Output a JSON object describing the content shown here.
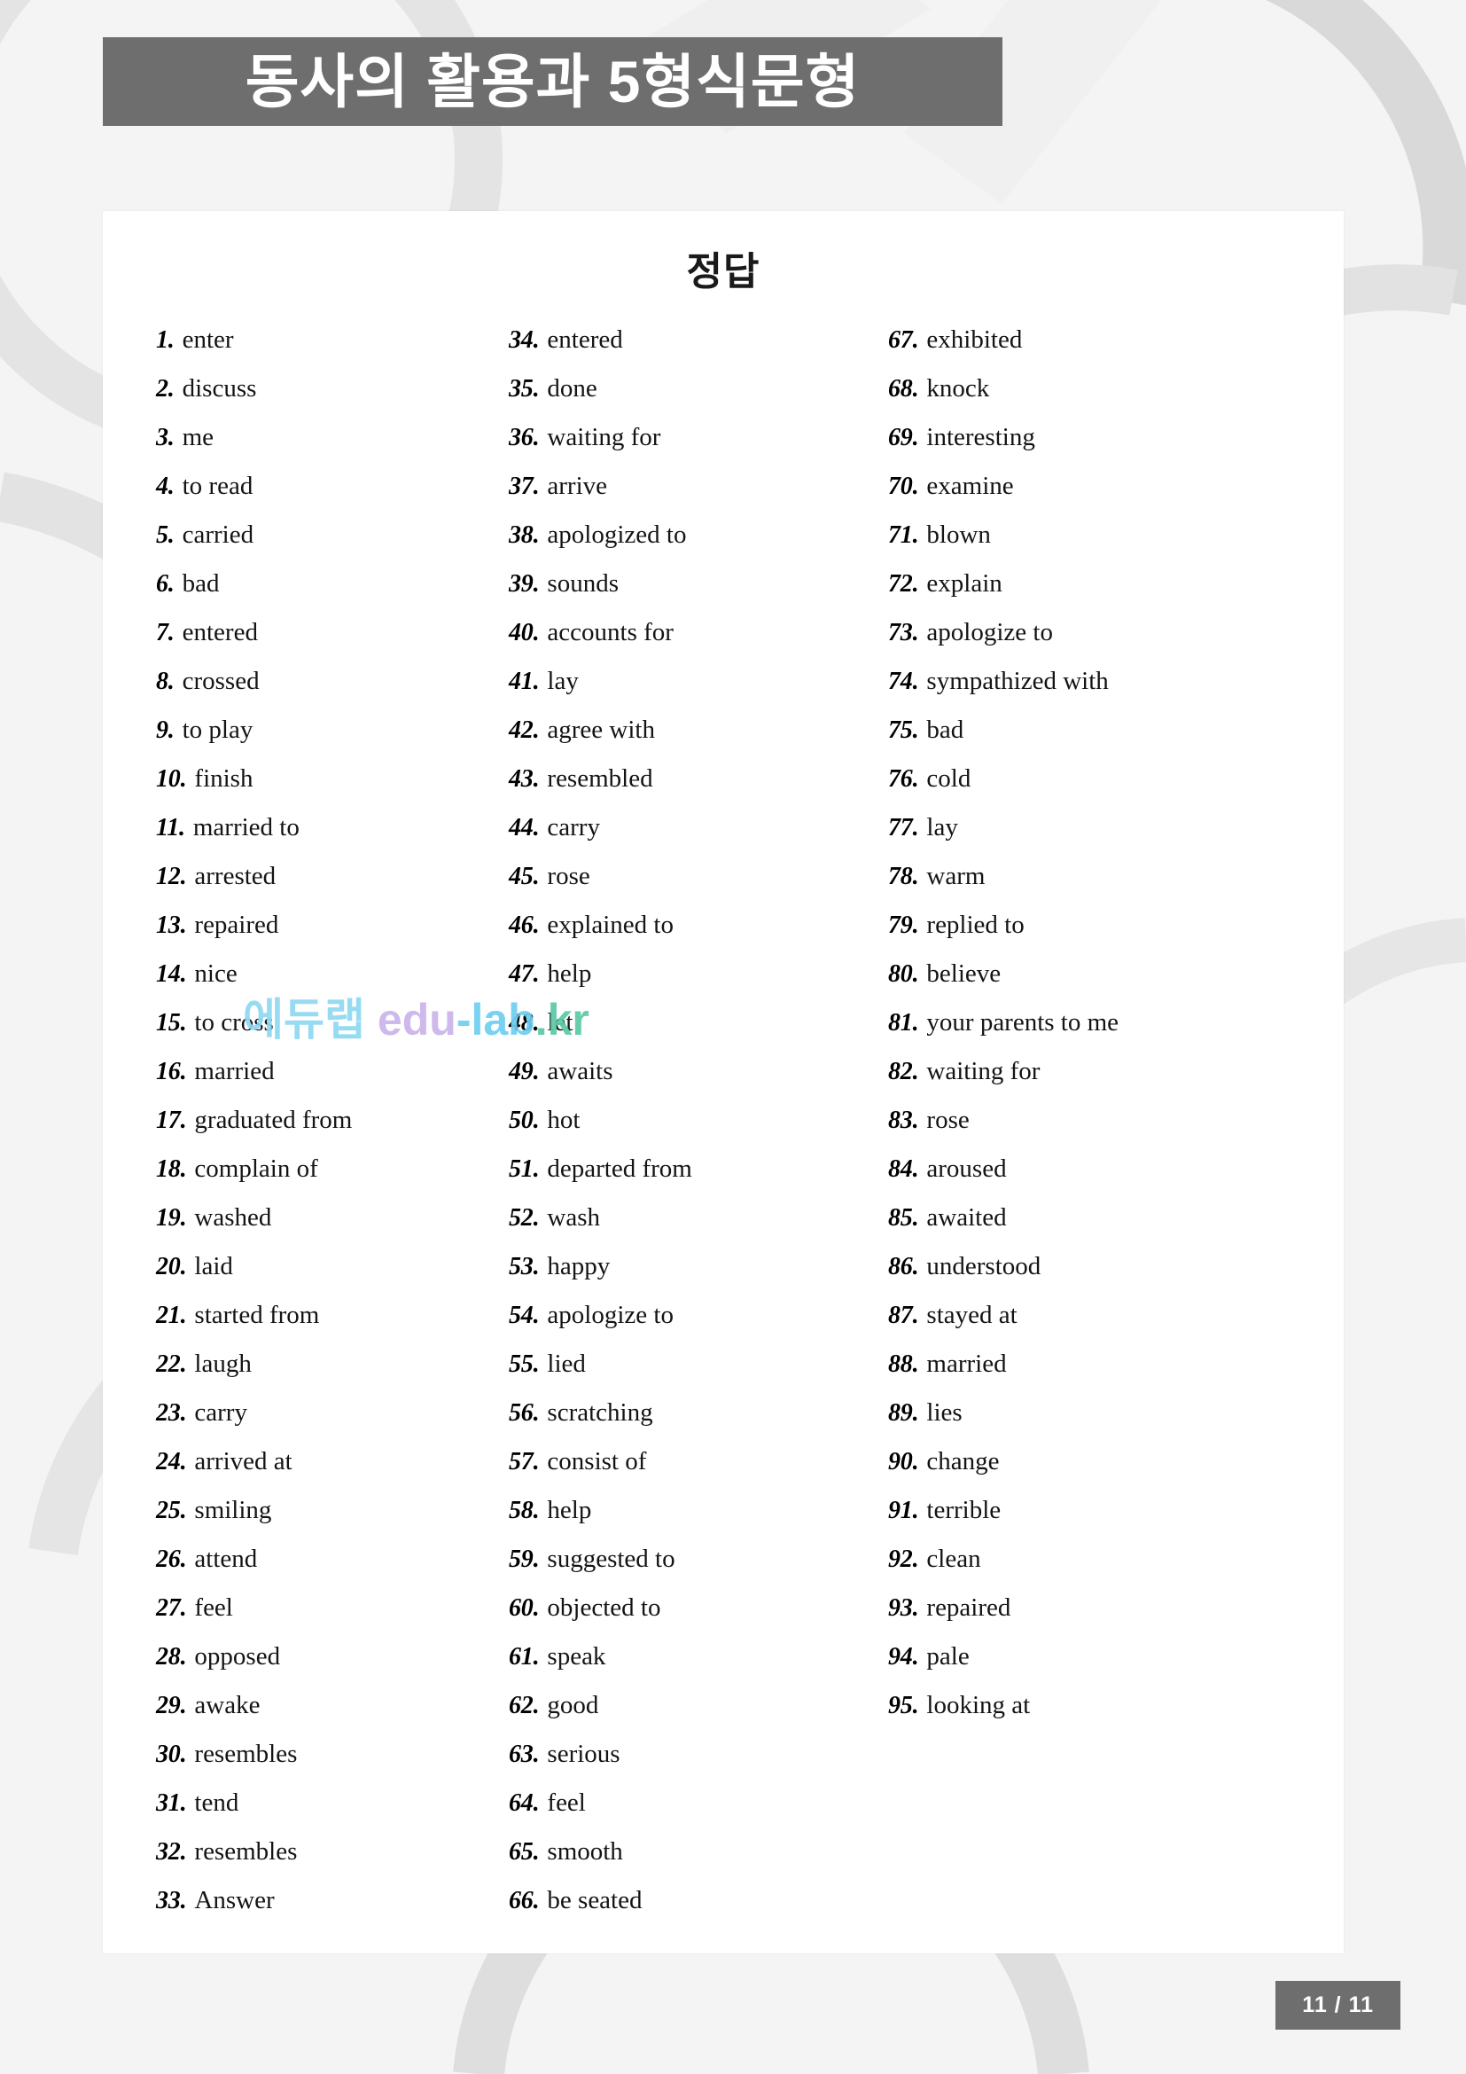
{
  "header": {
    "title": "동사의 활용과 5형식문형"
  },
  "sheet": {
    "heading": "정답"
  },
  "watermark": {
    "korean": "에듀랩",
    "edu": "edu",
    "dash_lab": "-lab",
    "dot_kr": ".kr",
    "full": "에듀랩 edu-lab.kr"
  },
  "footer": {
    "page_badge": "11 / 11",
    "current_page": 11,
    "total_pages": 11
  },
  "answers": {
    "columns": [
      {
        "id": "column-1",
        "items": [
          {
            "num": "1.",
            "text": "enter"
          },
          {
            "num": "2.",
            "text": "discuss"
          },
          {
            "num": "3.",
            "text": "me"
          },
          {
            "num": "4.",
            "text": "to read"
          },
          {
            "num": "5.",
            "text": "carried"
          },
          {
            "num": "6.",
            "text": "bad"
          },
          {
            "num": "7.",
            "text": "entered"
          },
          {
            "num": "8.",
            "text": "crossed"
          },
          {
            "num": "9.",
            "text": "to play"
          },
          {
            "num": "10.",
            "text": "finish"
          },
          {
            "num": "11.",
            "text": "married to"
          },
          {
            "num": "12.",
            "text": "arrested"
          },
          {
            "num": "13.",
            "text": "repaired"
          },
          {
            "num": "14.",
            "text": "nice"
          },
          {
            "num": "15.",
            "text": "to cross"
          },
          {
            "num": "16.",
            "text": "married"
          },
          {
            "num": "17.",
            "text": "graduated from"
          },
          {
            "num": "18.",
            "text": "complain of"
          },
          {
            "num": "19.",
            "text": "washed"
          },
          {
            "num": "20.",
            "text": "laid"
          },
          {
            "num": "21.",
            "text": "started from"
          },
          {
            "num": "22.",
            "text": "laugh"
          },
          {
            "num": "23.",
            "text": "carry"
          },
          {
            "num": "24.",
            "text": "arrived at"
          },
          {
            "num": "25.",
            "text": "smiling"
          },
          {
            "num": "26.",
            "text": "attend"
          },
          {
            "num": "27.",
            "text": "feel"
          },
          {
            "num": "28.",
            "text": "opposed"
          },
          {
            "num": "29.",
            "text": "awake"
          },
          {
            "num": "30.",
            "text": "resembles"
          },
          {
            "num": "31.",
            "text": "tend"
          },
          {
            "num": "32.",
            "text": "resembles"
          },
          {
            "num": "33.",
            "text": "Answer"
          }
        ]
      },
      {
        "id": "column-2",
        "items": [
          {
            "num": "34.",
            "text": "entered"
          },
          {
            "num": "35.",
            "text": "done"
          },
          {
            "num": "36.",
            "text": "waiting for"
          },
          {
            "num": "37.",
            "text": "arrive"
          },
          {
            "num": "38.",
            "text": "apologized to"
          },
          {
            "num": "39.",
            "text": "sounds"
          },
          {
            "num": "40.",
            "text": "accounts for"
          },
          {
            "num": "41.",
            "text": "lay"
          },
          {
            "num": "42.",
            "text": "agree with"
          },
          {
            "num": "43.",
            "text": "resembled"
          },
          {
            "num": "44.",
            "text": "carry"
          },
          {
            "num": "45.",
            "text": "rose"
          },
          {
            "num": "46.",
            "text": "explained to"
          },
          {
            "num": "47.",
            "text": "help"
          },
          {
            "num": "48.",
            "text": "let"
          },
          {
            "num": "49.",
            "text": "awaits"
          },
          {
            "num": "50.",
            "text": "hot"
          },
          {
            "num": "51.",
            "text": "departed from"
          },
          {
            "num": "52.",
            "text": "wash"
          },
          {
            "num": "53.",
            "text": "happy"
          },
          {
            "num": "54.",
            "text": "apologize to"
          },
          {
            "num": "55.",
            "text": "lied"
          },
          {
            "num": "56.",
            "text": "scratching"
          },
          {
            "num": "57.",
            "text": "consist of"
          },
          {
            "num": "58.",
            "text": "help"
          },
          {
            "num": "59.",
            "text": "suggested to"
          },
          {
            "num": "60.",
            "text": "objected to"
          },
          {
            "num": "61.",
            "text": "speak"
          },
          {
            "num": "62.",
            "text": "good"
          },
          {
            "num": "63.",
            "text": "serious"
          },
          {
            "num": "64.",
            "text": "feel"
          },
          {
            "num": "65.",
            "text": "smooth"
          },
          {
            "num": "66.",
            "text": "be seated"
          }
        ]
      },
      {
        "id": "column-3",
        "items": [
          {
            "num": "67.",
            "text": "exhibited"
          },
          {
            "num": "68.",
            "text": "knock"
          },
          {
            "num": "69.",
            "text": "interesting"
          },
          {
            "num": "70.",
            "text": "examine"
          },
          {
            "num": "71.",
            "text": "blown"
          },
          {
            "num": "72.",
            "text": "explain"
          },
          {
            "num": "73.",
            "text": "apologize to"
          },
          {
            "num": "74.",
            "text": "sympathized with"
          },
          {
            "num": "75.",
            "text": "bad"
          },
          {
            "num": "76.",
            "text": "cold"
          },
          {
            "num": "77.",
            "text": "lay"
          },
          {
            "num": "78.",
            "text": "warm"
          },
          {
            "num": "79.",
            "text": "replied to"
          },
          {
            "num": "80.",
            "text": "believe"
          },
          {
            "num": "81.",
            "text": "your parents to me"
          },
          {
            "num": "82.",
            "text": "waiting for"
          },
          {
            "num": "83.",
            "text": "rose"
          },
          {
            "num": "84.",
            "text": "aroused"
          },
          {
            "num": "85.",
            "text": "awaited"
          },
          {
            "num": "86.",
            "text": "understood"
          },
          {
            "num": "87.",
            "text": "stayed at"
          },
          {
            "num": "88.",
            "text": "married"
          },
          {
            "num": "89.",
            "text": "lies"
          },
          {
            "num": "90.",
            "text": "change"
          },
          {
            "num": "91.",
            "text": "terrible"
          },
          {
            "num": "92.",
            "text": "clean"
          },
          {
            "num": "93.",
            "text": "repaired"
          },
          {
            "num": "94.",
            "text": "pale"
          },
          {
            "num": "95.",
            "text": "looking at"
          }
        ]
      }
    ]
  },
  "colors": {
    "banner": "#6e6e6e",
    "page_background": "#f4f4f4",
    "sheet": "#ffffff",
    "text": "#111111",
    "watermark_blue": "#6ecff0",
    "watermark_purple": "#c9b4ea",
    "watermark_green": "#5bc9a7"
  }
}
